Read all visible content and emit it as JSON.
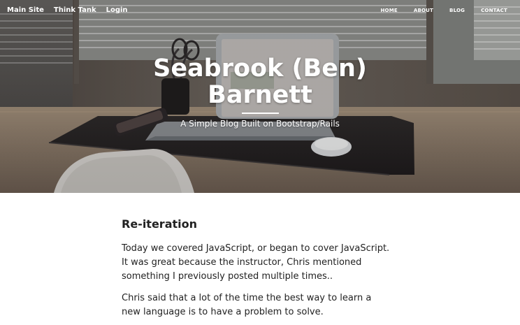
{
  "nav": {
    "left": [
      {
        "label": "Main Site"
      },
      {
        "label": "Think Tank"
      },
      {
        "label": "Login"
      }
    ],
    "right": [
      {
        "label": "HOME"
      },
      {
        "label": "ABOUT"
      },
      {
        "label": "BLOG"
      },
      {
        "label": "CONTACT"
      }
    ]
  },
  "hero": {
    "title_line1": "Seabrook (Ben)",
    "title_line2": "Barnett",
    "subtitle": "A Simple Blog Built on Bootstrap/Rails"
  },
  "post": {
    "title": "Re-iteration",
    "paragraphs": [
      "Today we covered JavaScript, or began to cover JavaScript. It was great because the instructor, Chris mentioned something I previously posted multiple times..",
      "Chris said that a lot of the time the best way to learn a new language is to have a problem to solve."
    ]
  },
  "colors": {
    "hero_overlay": "#3d3733",
    "body_text": "#222222",
    "background": "#ffffff"
  }
}
